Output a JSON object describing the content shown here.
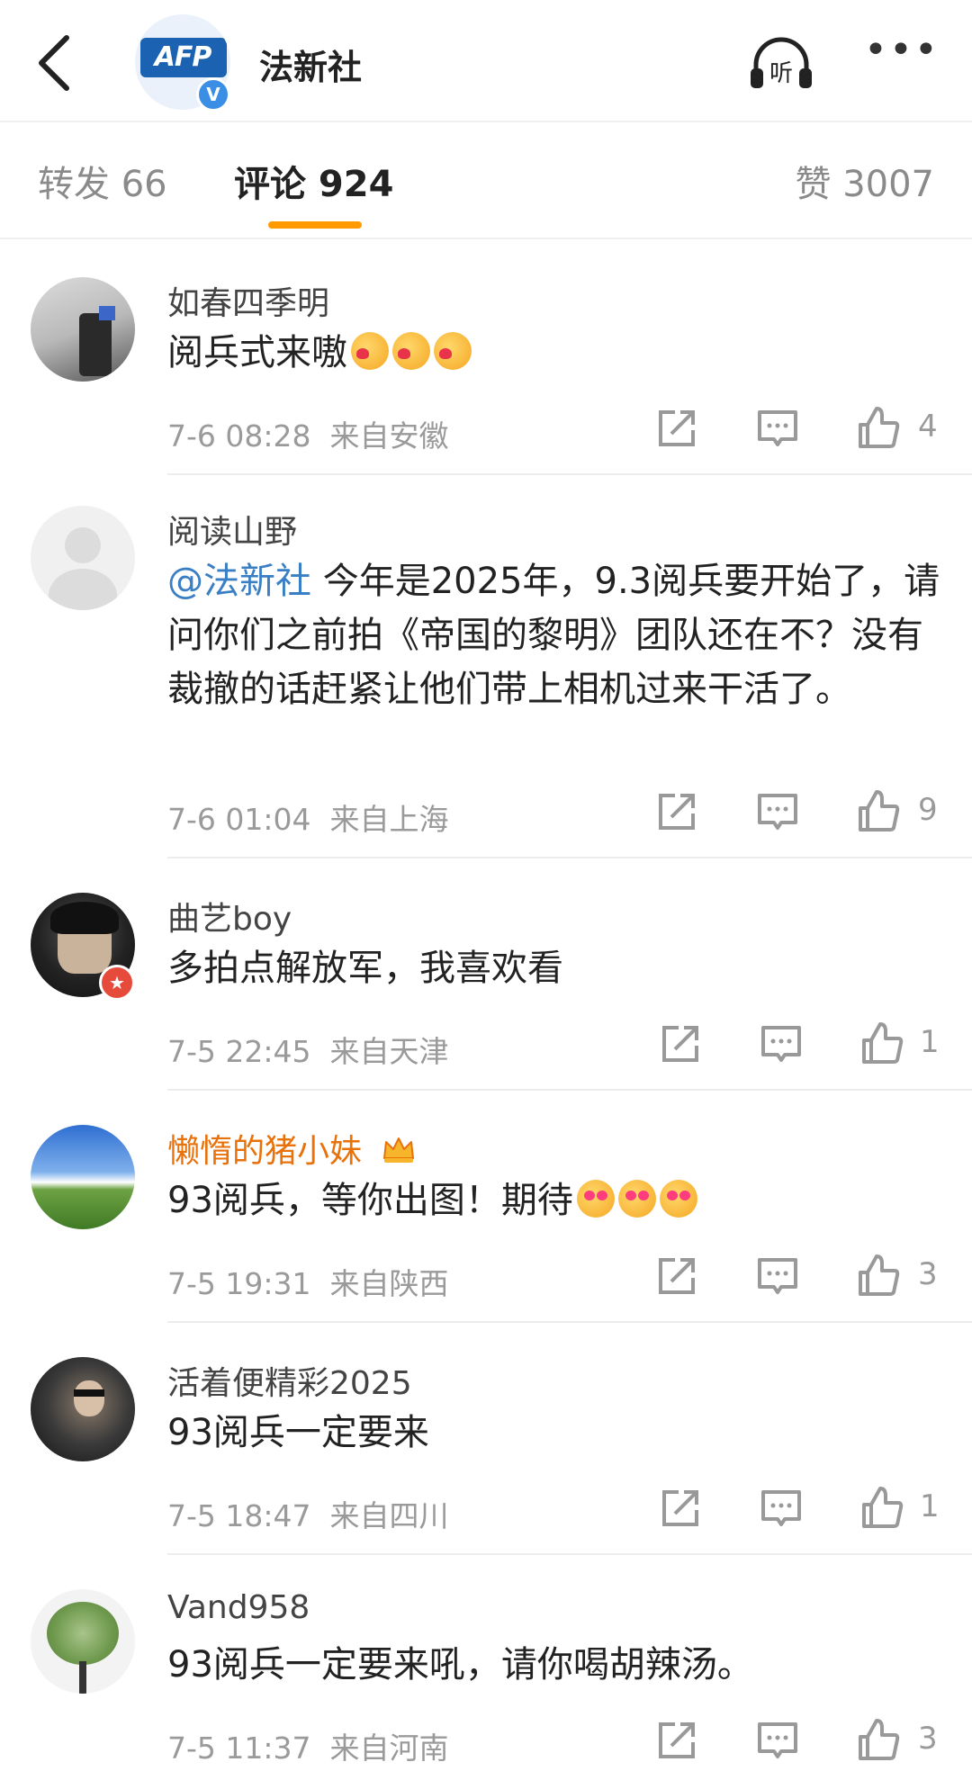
{
  "header": {
    "account_name": "法新社",
    "logo_text": "AFP",
    "verified_badge": "V",
    "listen_label": "听",
    "more_label": "•••"
  },
  "tabs": {
    "repost": "转发 66",
    "comment": "评论 924",
    "like": "赞 3007",
    "active": "comment",
    "accent_color": "#ff9a00"
  },
  "colors": {
    "mention": "#3a7fc4",
    "vip_name": "#e8710a",
    "meta": "#9a9a9a"
  },
  "comments": [
    {
      "username": "如春四季明",
      "text": "阅兵式来嗷",
      "emoji": [
        "heart-kiss-emoji",
        "heart-kiss-emoji",
        "heart-kiss-emoji"
      ],
      "time": "7-6 08:28",
      "location": "来自安徽",
      "likes": "4"
    },
    {
      "username": "阅读山野",
      "mention": "@法新社",
      "text": " 今年是2025年，9.3阅兵要开始了，请问你们之前拍《帝国的黎明》团队还在不？没有裁撤的话赶紧让他们带上相机过来干活了。",
      "time": "7-6 01:04",
      "location": "来自上海",
      "likes": "9"
    },
    {
      "username": "曲艺boy",
      "text": "多拍点解放军，我喜欢看",
      "time": "7-5 22:45",
      "location": "来自天津",
      "likes": "1"
    },
    {
      "username": "懒惰的猪小妹",
      "vip": true,
      "text": "93阅兵，等你出图！期待",
      "emoji": [
        "heart-eyes-emoji",
        "heart-eyes-emoji",
        "heart-eyes-emoji"
      ],
      "time": "7-5 19:31",
      "location": "来自陕西",
      "likes": "3"
    },
    {
      "username": "活着便精彩2025",
      "text": "93阅兵一定要来",
      "time": "7-5 18:47",
      "location": "来自四川",
      "likes": "1"
    },
    {
      "username": "Vand958",
      "text": "93阅兵一定要来吼，请你喝胡辣汤。",
      "time": "7-5 11:37",
      "location": "来自河南",
      "likes": "3"
    }
  ]
}
